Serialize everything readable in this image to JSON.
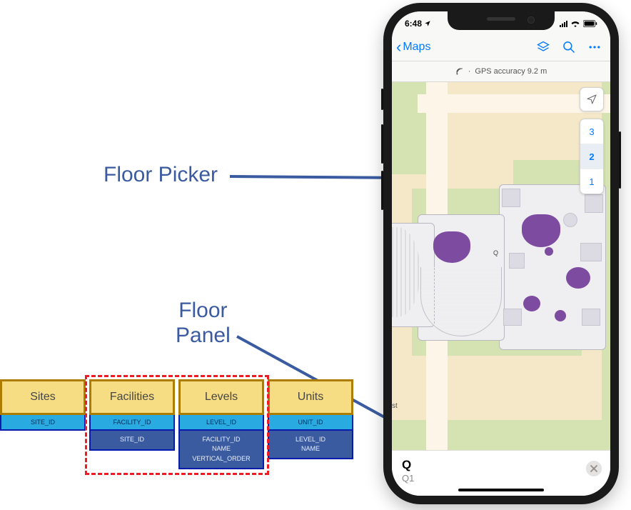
{
  "annotations": {
    "floor_picker_label": "Floor Picker",
    "floor_panel_label_line1": "Floor",
    "floor_panel_label_line2": "Panel"
  },
  "phone": {
    "status": {
      "time": "6:48"
    },
    "navbar": {
      "back_label": "Maps"
    },
    "gps_text": "GPS accuracy 9.2 m",
    "floors": [
      "3",
      "2",
      "1"
    ],
    "selected_floor_index": 1,
    "map_label_q": "Q",
    "map_scale": "st",
    "panel": {
      "title": "Q",
      "subtitle": "Q1"
    }
  },
  "tables": {
    "columns": [
      {
        "header": "Sites",
        "pk": "SITE_ID",
        "fks": []
      },
      {
        "header": "Facilities",
        "pk": "FACILITY_ID",
        "fks": [
          "SITE_ID"
        ]
      },
      {
        "header": "Levels",
        "pk": "LEVEL_ID",
        "fks": [
          "FACILITY_ID",
          "NAME",
          "VERTICAL_ORDER"
        ]
      },
      {
        "header": "Units",
        "pk": "UNIT_ID",
        "fks": [
          "LEVEL_ID",
          "NAME"
        ]
      }
    ],
    "highlight_range": [
      1,
      2
    ]
  }
}
